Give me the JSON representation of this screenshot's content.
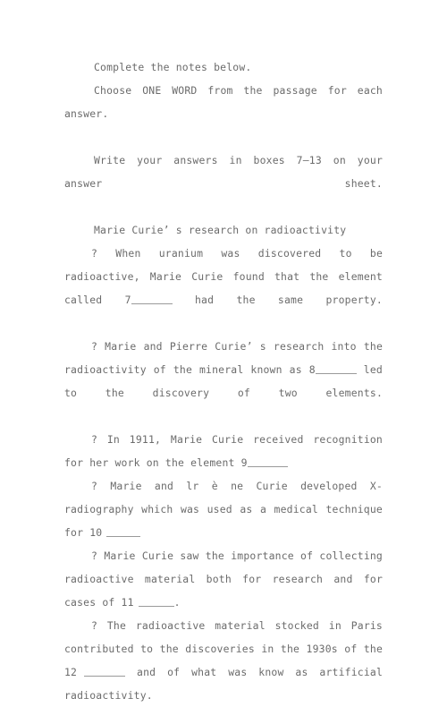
{
  "document": {
    "instructions": [
      {
        "id": "instruction-complete-notes",
        "text": "Complete the notes below."
      },
      {
        "id": "instruction-choose-one-word",
        "text": "Choose ONE WORD from the passage for each answer."
      },
      {
        "id": "instruction-write-answers",
        "text": "Write your answers in boxes 7—13 on your answer sheet."
      }
    ],
    "heading": {
      "id": "notes-heading",
      "text": "Marie Curie’ s research on radioactivity"
    },
    "notes": [
      {
        "id": "note-7",
        "bullet": "?",
        "text_before": "When uranium was discovered to be radioactive, Marie Curie found that the element called 7",
        "blank_number": "7",
        "text_after": "had the same property."
      },
      {
        "id": "note-8",
        "bullet": "?",
        "text_before": "Marie and Pierre Curie’ s research into the radioactivity of the mineral known as 8",
        "blank_number": "8",
        "text_after": "led to the discovery of two elements."
      },
      {
        "id": "note-9",
        "bullet": "?",
        "text_before": "In 1911, Marie Curie received recognition for her work on the element 9",
        "blank_number": "9",
        "text_after": ""
      },
      {
        "id": "note-10",
        "bullet": "?",
        "text_before": "Marie and lr è ne Curie developed X-radiography which was used as a medical technique for 10",
        "blank_number": "10",
        "text_after": ""
      },
      {
        "id": "note-11",
        "bullet": "?",
        "text_before": "Marie Curie saw the importance of collecting radioactive material both for research and for cases of 11",
        "blank_number": "11",
        "text_after": "."
      },
      {
        "id": "note-12",
        "bullet": "?",
        "text_before": "The radioactive material stocked in Paris contributed to the discoveries in the 1930s of the 12",
        "blank_number": "12",
        "text_after": "and of what was know as artificial radioactivity."
      }
    ],
    "style": {
      "text_color": "#6b6b6b",
      "background_color": "#ffffff",
      "blank_rule_color": "#9a9a9a"
    }
  }
}
